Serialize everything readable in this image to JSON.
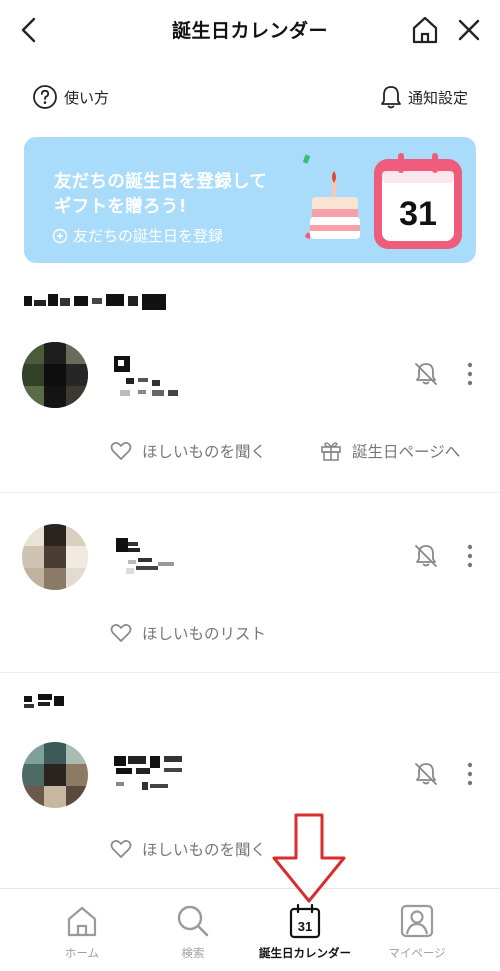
{
  "header": {
    "title": "誕生日カレンダー"
  },
  "subbar": {
    "howto_label": "使い方",
    "notification_label": "通知設定"
  },
  "banner": {
    "line1": "友だちの誕生日を登録して",
    "line2": "ギフトを贈ろう!",
    "register_label": "友だちの誕生日を登録",
    "calendar_number": "31"
  },
  "friends": [
    {
      "actions": [
        "ほしいものを聞く",
        "誕生日ページへ"
      ]
    },
    {
      "actions": [
        "ほしいものリスト"
      ]
    },
    {
      "actions": [
        "ほしいものを聞く"
      ]
    }
  ],
  "tabbar": {
    "tabs": [
      {
        "label": "ホーム",
        "icon": "home-icon"
      },
      {
        "label": "検索",
        "icon": "search-icon"
      },
      {
        "label": "誕生日カレンダー",
        "icon": "calendar-icon",
        "active": true
      },
      {
        "label": "マイページ",
        "icon": "profile-icon"
      }
    ],
    "calendar_icon_number": "31"
  },
  "colors": {
    "banner_bg": "#a9dcfb",
    "calendar_pink": "#f05d7c",
    "annotation_arrow": "#d92c2c"
  }
}
